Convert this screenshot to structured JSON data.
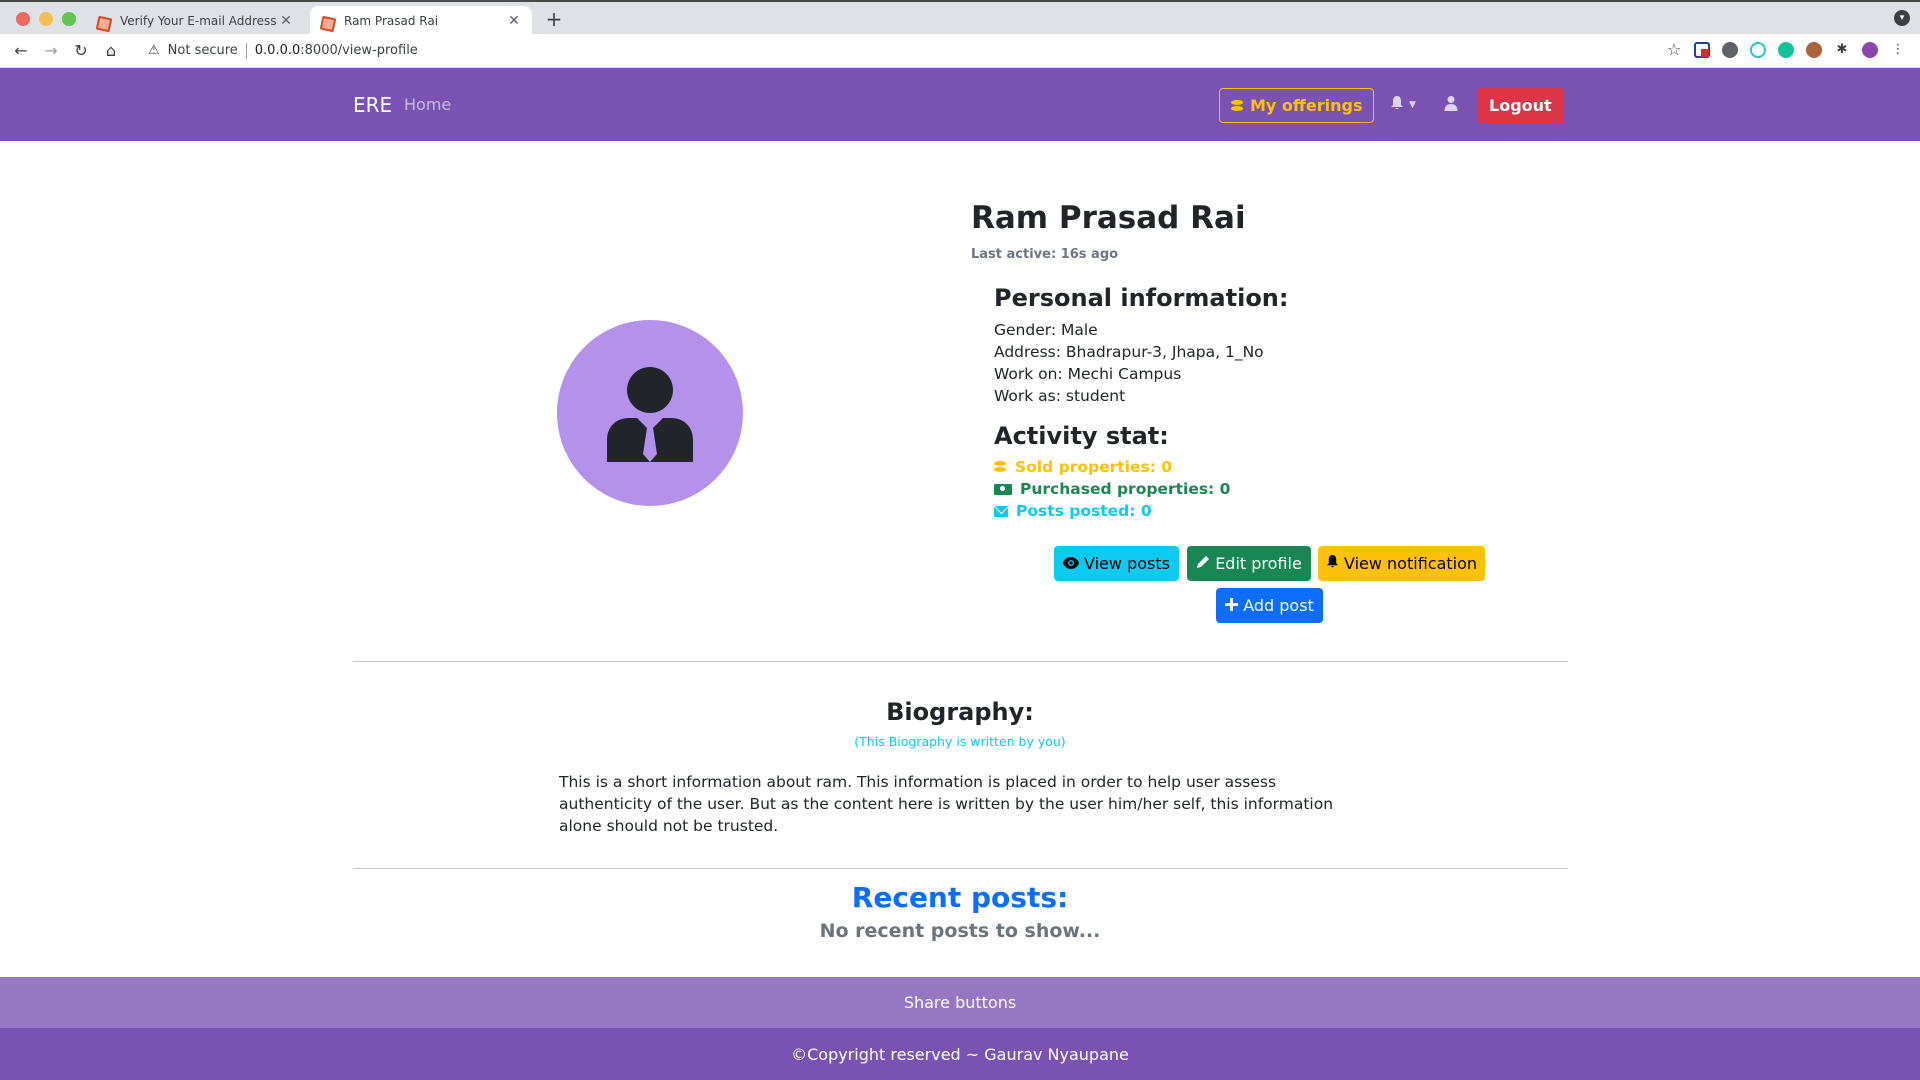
{
  "browser": {
    "tabs": [
      {
        "title": "Verify Your E-mail Address"
      },
      {
        "title": "Ram Prasad Rai"
      }
    ],
    "security": "Not secure",
    "url_host": "0.0.0.0",
    "url_rest": ":8000/view-profile"
  },
  "navbar": {
    "brand": "ERE",
    "home": "Home",
    "offerings": "My offerings",
    "logout": "Logout"
  },
  "profile": {
    "name": "Ram Prasad Rai",
    "last_active": "Last active: 16s ago",
    "personal_heading": "Personal information:",
    "gender": "Gender: Male",
    "address": "Address: Bhadrapur-3, Jhapa, 1_No",
    "work_on": "Work on: Mechi Campus",
    "work_as": "Work as: student",
    "activity_heading": "Activity stat:",
    "sold": "Sold properties: 0",
    "purchased": "Purchased properties: 0",
    "posts": "Posts posted: 0"
  },
  "actions": {
    "view_posts": "View posts",
    "edit_profile": "Edit profile",
    "view_notification": "View notification",
    "add_post": "Add post"
  },
  "biography": {
    "title": "Biography:",
    "subtitle": "(This Biography is written by you)",
    "text": "This is a short information about ram. This information is placed in order to help user assess authenticity of the user. But as the content here is written by the user him/her self, this information alone should not be trusted."
  },
  "recent": {
    "title": "Recent posts:",
    "empty": "No recent posts to show..."
  },
  "footer": {
    "share": "Share buttons",
    "copyright": "©Copyright reserved ~ Gaurav Nyaupane"
  },
  "colors": {
    "navbar": "#7952b3",
    "avatar_bg": "#b591ec",
    "share_bar": "#9577c2"
  }
}
